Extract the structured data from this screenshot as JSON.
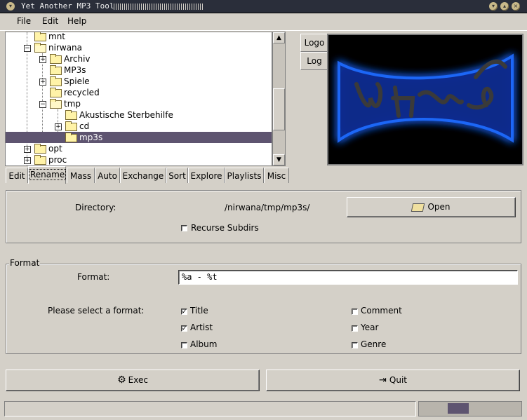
{
  "window": {
    "title": "Yet Another MP3 Tool"
  },
  "menu": {
    "file": "File",
    "edit": "Edit",
    "help": "Help"
  },
  "tree": {
    "items": [
      {
        "label": "mnt",
        "depth": 1,
        "expander": "",
        "open": false
      },
      {
        "label": "nirwana",
        "depth": 1,
        "expander": "−",
        "open": true
      },
      {
        "label": "Archiv",
        "depth": 2,
        "expander": "+",
        "open": false
      },
      {
        "label": "MP3s",
        "depth": 2,
        "expander": "",
        "open": false
      },
      {
        "label": "Spiele",
        "depth": 2,
        "expander": "+",
        "open": false
      },
      {
        "label": "recycled",
        "depth": 2,
        "expander": "",
        "open": false
      },
      {
        "label": "tmp",
        "depth": 2,
        "expander": "−",
        "open": true
      },
      {
        "label": "Akustische Sterbehilfe",
        "depth": 3,
        "expander": "",
        "open": false
      },
      {
        "label": "cd",
        "depth": 3,
        "expander": "+",
        "open": false
      },
      {
        "label": "mp3s",
        "depth": 3,
        "expander": "",
        "open": false,
        "selected": true
      },
      {
        "label": "opt",
        "depth": 1,
        "expander": "+",
        "open": false
      },
      {
        "label": "proc",
        "depth": 1,
        "expander": "+",
        "open": false
      }
    ]
  },
  "side_tabs": {
    "logo": "Logo",
    "log": "Log"
  },
  "logo": {
    "text": "YAMT",
    "glow_color": "#1e6bff"
  },
  "tabs": [
    "Edit",
    "Rename",
    "Mass",
    "Auto",
    "Exchange",
    "Sort",
    "Explore",
    "Playlists",
    "Misc"
  ],
  "active_tab": "Rename",
  "rename": {
    "directory_label": "Directory:",
    "directory_value": "/nirwana/tmp/mp3s/",
    "open_button": "Open",
    "recurse_label": "Recurse Subdirs",
    "format_group": "Format",
    "format_label": "Format:",
    "format_value": "%a - %t",
    "select_label": "Please select a format:",
    "options": {
      "title": "Title",
      "artist": "Artist",
      "album": "Album",
      "comment": "Comment",
      "year": "Year",
      "genre": "Genre"
    },
    "exec_button": "Exec",
    "quit_button": "Quit"
  },
  "colors": {
    "selection": "#5e5470",
    "titlebar": "#2a2e3a"
  }
}
